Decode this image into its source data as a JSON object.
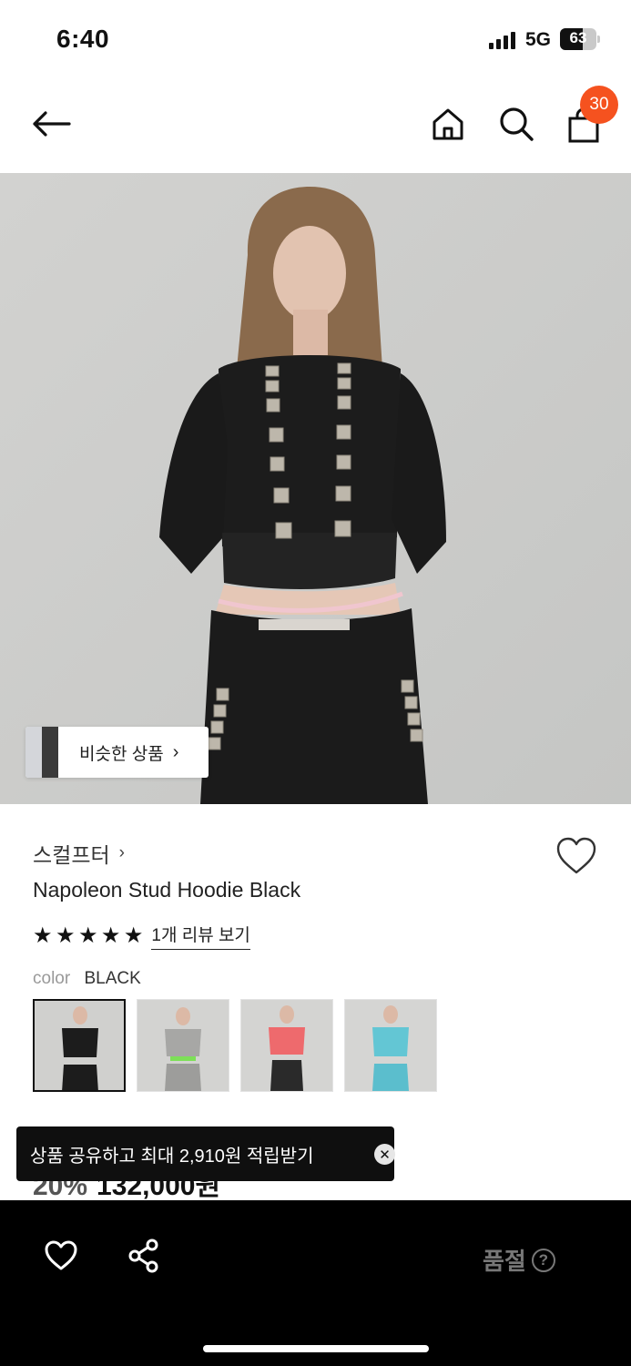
{
  "status_bar": {
    "time": "6:40",
    "network": "5G",
    "battery": "63",
    "battery_level": 0.63
  },
  "nav": {
    "back_icon": "back-arrow-icon",
    "home_icon": "home-icon",
    "search_icon": "search-icon",
    "cart_icon": "shopping-bag-icon",
    "cart_count": "30"
  },
  "hero": {
    "similar_label": "비슷한 상품",
    "similar_chevron": "›"
  },
  "product": {
    "brand": "스컬프터",
    "brand_chevron": "›",
    "title": "Napoleon Stud Hoodie Black",
    "rating_stars": 5,
    "stars": [
      "★",
      "★",
      "★",
      "★",
      "★"
    ],
    "review_link": "1개 리뷰 보기",
    "color_label": "color",
    "color_value": "BLACK",
    "swatches": [
      "BLACK",
      "GRAY",
      "PINK",
      "SKY BLUE"
    ],
    "price_discount": "20%",
    "price_value": "132,000원"
  },
  "toast": {
    "text": "상품 공유하고 최대 2,910원 적립받기",
    "close": "✕"
  },
  "bottom_bar": {
    "sold_out": "품절",
    "help": "?"
  },
  "colors": {
    "accent_badge": "#f5521f",
    "bottom_bar": "#000000",
    "toast_bg": "#0f0f0f"
  }
}
